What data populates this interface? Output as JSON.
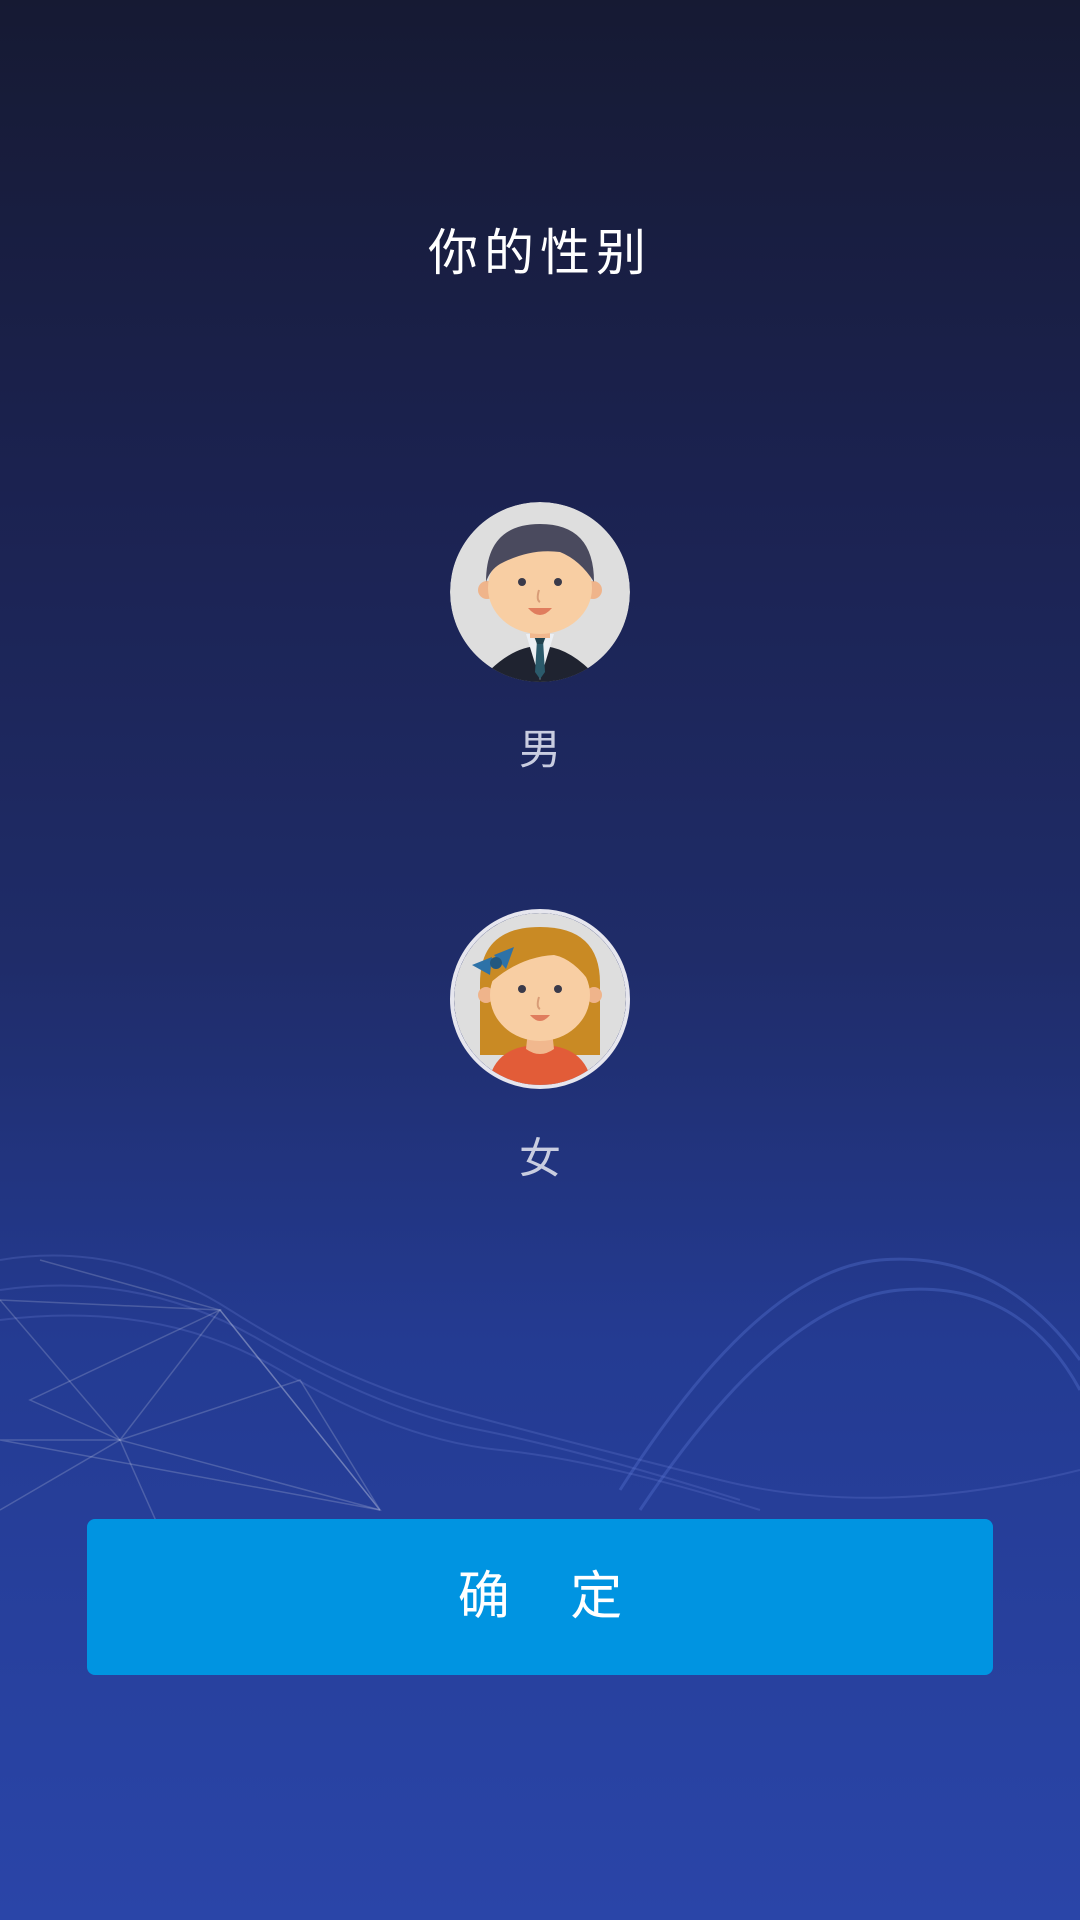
{
  "page": {
    "title": "你的性别"
  },
  "options": [
    {
      "id": "male",
      "label": "男",
      "icon": "male-avatar-icon",
      "selected": false
    },
    {
      "id": "female",
      "label": "女",
      "icon": "female-avatar-icon",
      "selected": true
    }
  ],
  "confirm": {
    "label": "确 定"
  },
  "colors": {
    "background_top": "#161a33",
    "background_bottom": "#2a45a8",
    "button": "#0094e1",
    "text": "#ffffff",
    "label": "#c9cde0"
  }
}
